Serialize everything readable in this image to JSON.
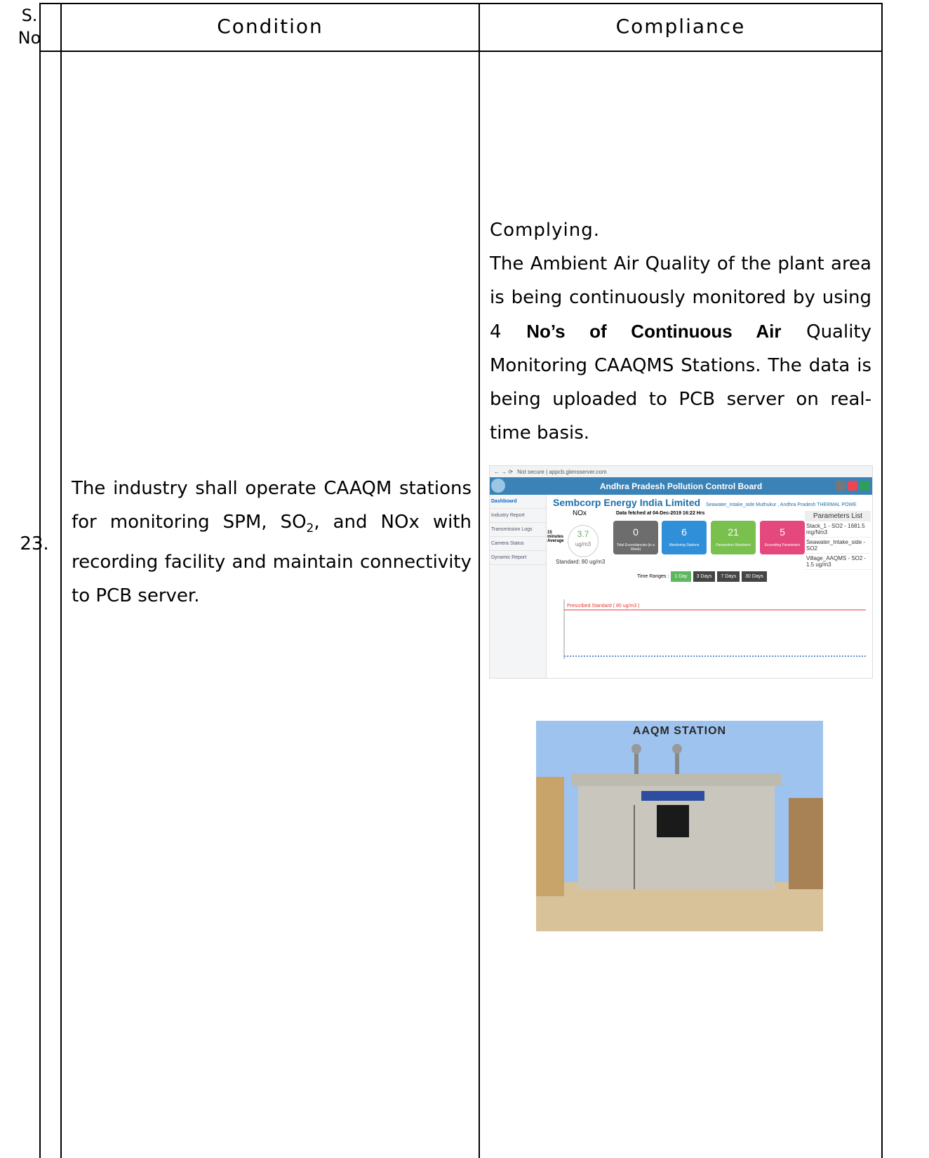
{
  "header": {
    "sno": "S. No",
    "condition": "Condition",
    "compliance": "Compliance"
  },
  "row": {
    "number": "23.",
    "condition_pre": "The industry shall operate CAAQM stations for monitoring SPM, SO",
    "condition_sub": "2",
    "condition_post": ", and NOx with recording facility and maintain connectivity to PCB server.",
    "compliance_lead": "Complying.",
    "compliance_p1": "The Ambient Air Quality of the plant area is being continuously monitored by using 4 ",
    "compliance_bold": "No’s of Continuous Air",
    "compliance_p2": " Quality Monitoring CAAQMS Stations. The data is being uploaded to PCB server on real-time basis."
  },
  "dashboard": {
    "address": "Not secure | appcb.glensserver.com",
    "board_title": "Andhra Pradesh Pollution Control Board",
    "company": "Sembcorp Energy India Limited",
    "location": "Seawater_Intake_side  Muthukur , Andhra Pradesh  THERMAL POWE",
    "nav": [
      "Dashboard",
      "Industry Report",
      "Transmission Logs",
      "Camera Status",
      "Dynamic Report"
    ],
    "param": "NOx",
    "avg_label": "15 minutes Average",
    "value": "3.7",
    "unit": "ug/m3",
    "standard": "Standard: 80 ug/m3",
    "fetched": "Data fetched at 04-Dec-2019 16:22 Hrs",
    "cards": [
      {
        "n": "0",
        "l": "Total Exceedancies (in a Week)",
        "color": "#6d6d6d"
      },
      {
        "n": "6",
        "l": "Monitoring Stations",
        "color": "#2f8fd8"
      },
      {
        "n": "21",
        "l": "Parameters Monitored",
        "color": "#79c04e"
      },
      {
        "n": "5",
        "l": "Exceeding Parameters",
        "color": "#e5487d"
      }
    ],
    "plist_title": "Parameters List",
    "plist": [
      "Stack_1 - SO2 - 1681.5 mg/Nm3",
      "Seawater_Intake_side - SO2",
      "Village_AAQMS - SO2 - 1.5 ug/m3"
    ],
    "ranges_label": "Time Ranges :",
    "ranges": [
      "1 Day",
      "3 Days",
      "7 Days",
      "30 Days"
    ],
    "prescribed": "Prescribed Standard ( 80 ug/m3 )"
  },
  "photo": {
    "title": "AAQM STATION"
  }
}
